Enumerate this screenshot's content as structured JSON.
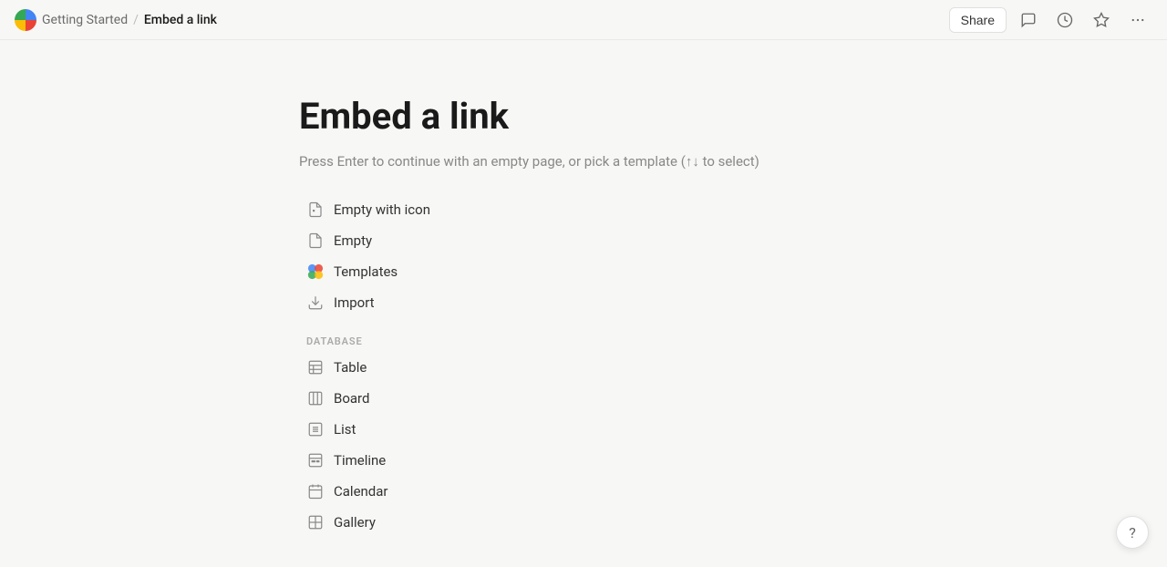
{
  "topbar": {
    "breadcrumb_parent": "Getting Started",
    "breadcrumb_sep": "/",
    "breadcrumb_current": "Embed a link",
    "share_label": "Share"
  },
  "page": {
    "title": "Embed a link",
    "subtitle": "Press Enter to continue with an empty page, or pick a template (↑↓ to select)"
  },
  "menu_items": [
    {
      "id": "empty-with-icon",
      "label": "Empty with icon",
      "icon": "doc-icon"
    },
    {
      "id": "empty",
      "label": "Empty",
      "icon": "doc-plain-icon"
    },
    {
      "id": "templates",
      "label": "Templates",
      "icon": "templates-icon"
    },
    {
      "id": "import",
      "label": "Import",
      "icon": "import-icon"
    }
  ],
  "database_section_label": "DATABASE",
  "database_items": [
    {
      "id": "table",
      "label": "Table",
      "icon": "table-icon"
    },
    {
      "id": "board",
      "label": "Board",
      "icon": "board-icon"
    },
    {
      "id": "list",
      "label": "List",
      "icon": "list-icon"
    },
    {
      "id": "timeline",
      "label": "Timeline",
      "icon": "timeline-icon"
    },
    {
      "id": "calendar",
      "label": "Calendar",
      "icon": "calendar-icon"
    },
    {
      "id": "gallery",
      "label": "Gallery",
      "icon": "gallery-icon"
    }
  ],
  "help_label": "?"
}
